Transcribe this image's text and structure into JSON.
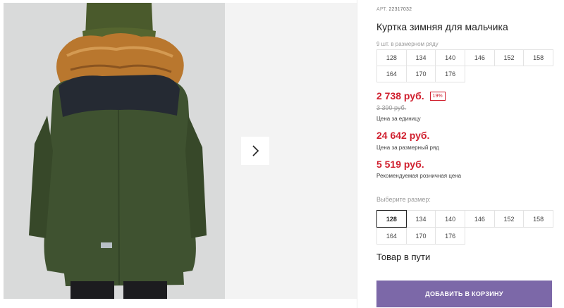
{
  "product": {
    "art_label": "АРТ.",
    "art_number": "22317032",
    "title": "Куртка зимняя для мальчика",
    "size_row_note": "9 шт. в размерном ряду",
    "size_row": [
      "128",
      "134",
      "140",
      "146",
      "152",
      "158",
      "164",
      "170",
      "176"
    ]
  },
  "pricing": {
    "price": "2 738 руб.",
    "discount": "19%",
    "old_price": "3 390 руб.",
    "unit_caption": "Цена за единицу",
    "row_price": "24 642 руб.",
    "row_caption": "Цена за размерный ряд",
    "retail_price": "5 519 руб.",
    "retail_caption": "Рекомендуемая розничная цена"
  },
  "size_picker": {
    "label": "Выберите размер:",
    "sizes": [
      "128",
      "134",
      "140",
      "146",
      "152",
      "158",
      "164",
      "170",
      "176"
    ],
    "selected": "128"
  },
  "availability": "Товар в пути",
  "cart_button": "ДОБАВИТЬ В КОРЗИНУ",
  "icons": {
    "next": "chevron-right-icon"
  },
  "colors": {
    "price": "#d0202f",
    "cart_button": "#7c68a8",
    "jacket": "#3f5230"
  }
}
